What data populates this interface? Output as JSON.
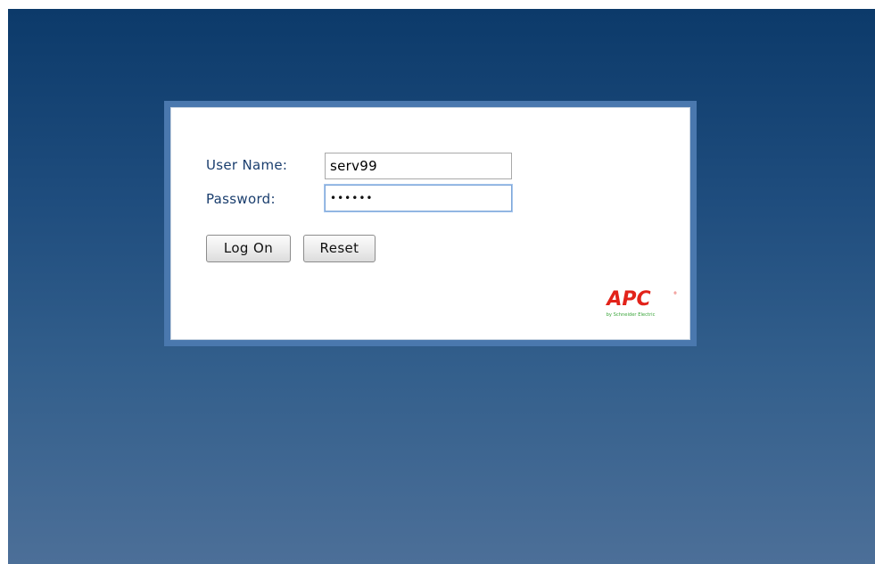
{
  "form": {
    "username_label": "User Name:",
    "username_value": "serv99",
    "password_label": "Password:",
    "password_value": "••••••",
    "logon_label": "Log On",
    "reset_label": "Reset"
  },
  "logo": {
    "brand": "APC",
    "tagline": "by Schneider Electric",
    "brand_color": "#e2231a"
  },
  "colors": {
    "background_top": "#0c3a6a",
    "background_bottom": "#4c6f98",
    "frame_border": "#4a78ae",
    "label_text": "#1a3e6e"
  }
}
